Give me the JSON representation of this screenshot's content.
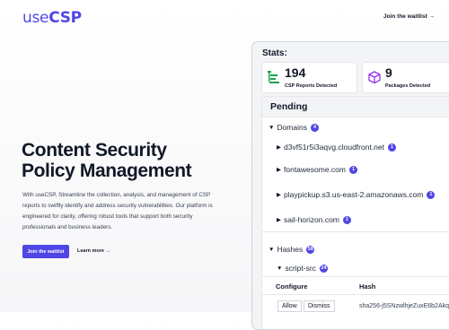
{
  "header": {
    "logo_prefix": "use",
    "logo_suffix": "CSP",
    "waitlist_link": "Join the waitlist →"
  },
  "hero": {
    "title": "Content Security Policy Management",
    "description": "With useCSP, Streamline the collection, analysis, and management of CSP reports to swiftly identify and address security vulnerabilities. Our platform is engineered for clarity, offering robust tools that support both security professionals and business leaders.",
    "primary_button": "Join the waitlist",
    "secondary_link": "Learn more →"
  },
  "stats": {
    "title": "Stats:",
    "cards": [
      {
        "value": "194",
        "label": "CSP Reports Detected",
        "icon": "list-icon"
      },
      {
        "value": "9",
        "label": "Packages Detected",
        "icon": "package-icon"
      }
    ]
  },
  "pending": {
    "title": "Pending",
    "domains": {
      "label": "Domains",
      "count": "4",
      "items": [
        {
          "name": "d3vf51r5i3aqvg.cloudfront.net",
          "count": "1"
        },
        {
          "name": "fontawesome.com",
          "count": "1"
        },
        {
          "name": "playpickup.s3.us-east-2.amazonaws.com",
          "count": "1"
        },
        {
          "name": "sail-horizon.com",
          "count": "1"
        }
      ]
    },
    "hashes": {
      "label": "Hashes",
      "count": "58",
      "directive": {
        "label": "script-src",
        "count": "24"
      },
      "columns": [
        "Configure",
        "Hash"
      ],
      "rows": [
        {
          "allow": "Allow",
          "dismiss": "Dismiss",
          "hash": "sha256-j5SNzwlhjeZuxE6b2Akq"
        }
      ]
    }
  },
  "colors": {
    "accent": "#4f46e5",
    "icon_green": "#16a34a",
    "icon_purple": "#9333ea"
  }
}
